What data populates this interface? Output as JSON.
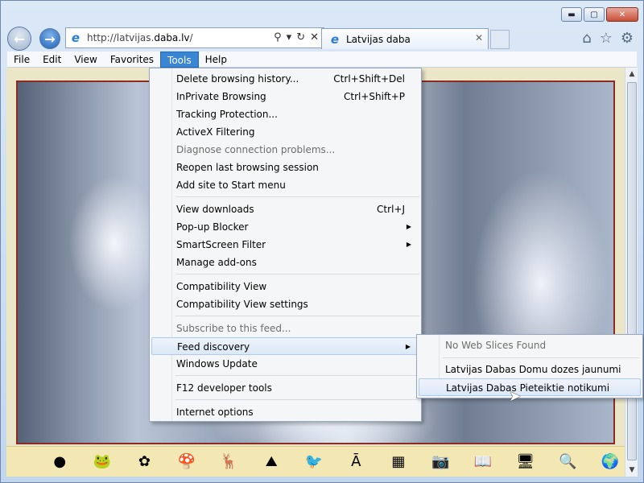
{
  "window": {
    "minimize_label": "▬",
    "maximize_label": "▢",
    "close_label": "✕"
  },
  "nav": {
    "back_icon": "back-arrow-icon",
    "forward_icon": "forward-arrow-icon"
  },
  "address": {
    "prefix": "http://latvijas.",
    "domain": "daba.lv",
    "suffix": "/",
    "icons": [
      "search-icon",
      "dropdown-icon",
      "refresh-icon",
      "stop-icon"
    ]
  },
  "tab": {
    "title": "Latvijas daba",
    "close": "✕"
  },
  "toolbar_icons": [
    "home-icon",
    "favorites-star-icon",
    "gear-icon"
  ],
  "menubar": {
    "items": [
      "File",
      "Edit",
      "View",
      "Favorites",
      "Tools",
      "Help"
    ],
    "active": "Tools"
  },
  "tools_menu": {
    "items": [
      {
        "label": "Delete browsing history...",
        "accel": "Ctrl+Shift+Del"
      },
      {
        "label": "InPrivate Browsing",
        "accel": "Ctrl+Shift+P"
      },
      {
        "label": "Tracking Protection...",
        "accel": ""
      },
      {
        "label": "ActiveX Filtering",
        "accel": ""
      },
      {
        "label": "Diagnose connection problems...",
        "accel": "",
        "disabled": true
      },
      {
        "label": "Reopen last browsing session",
        "accel": ""
      },
      {
        "label": "Add site to Start menu",
        "accel": ""
      },
      {
        "label": "View downloads",
        "accel": "Ctrl+J"
      },
      {
        "label": "Pop-up Blocker",
        "accel": "",
        "submenu": true
      },
      {
        "label": "SmartScreen Filter",
        "accel": "",
        "submenu": true
      },
      {
        "label": "Manage add-ons",
        "accel": ""
      },
      {
        "label": "Compatibility View",
        "accel": ""
      },
      {
        "label": "Compatibility View settings",
        "accel": ""
      },
      {
        "label": "Subscribe to this feed...",
        "accel": "",
        "disabled": true
      },
      {
        "label": "Feed discovery",
        "accel": "",
        "submenu": true,
        "highlighted": true
      },
      {
        "label": "Windows Update",
        "accel": ""
      },
      {
        "label": "F12 developer tools",
        "accel": ""
      },
      {
        "label": "Internet options",
        "accel": ""
      }
    ]
  },
  "feed_submenu": {
    "items": [
      {
        "label": "No Web Slices Found",
        "disabled": true
      },
      {
        "label": "Latvijas Dabas Domu dozes jaunumi"
      },
      {
        "label": "Latvijas Dabas Pieteiktie notikumi",
        "highlighted": true
      }
    ]
  },
  "page_icons": [
    "stone-icon",
    "frog-icon",
    "flower-icon",
    "mushroom-icon",
    "deer-icon",
    "landscape-icon",
    "bird-icon",
    "alphabet-icon",
    "table-icon",
    "camera-icon",
    "book-icon",
    "computer-icon",
    "magnifier-icon",
    "globe-icon"
  ],
  "colors": {
    "menu_highlight": "#3a86d4",
    "photo_border": "#8b2b21",
    "icon_bar": "#f3e8b3"
  }
}
